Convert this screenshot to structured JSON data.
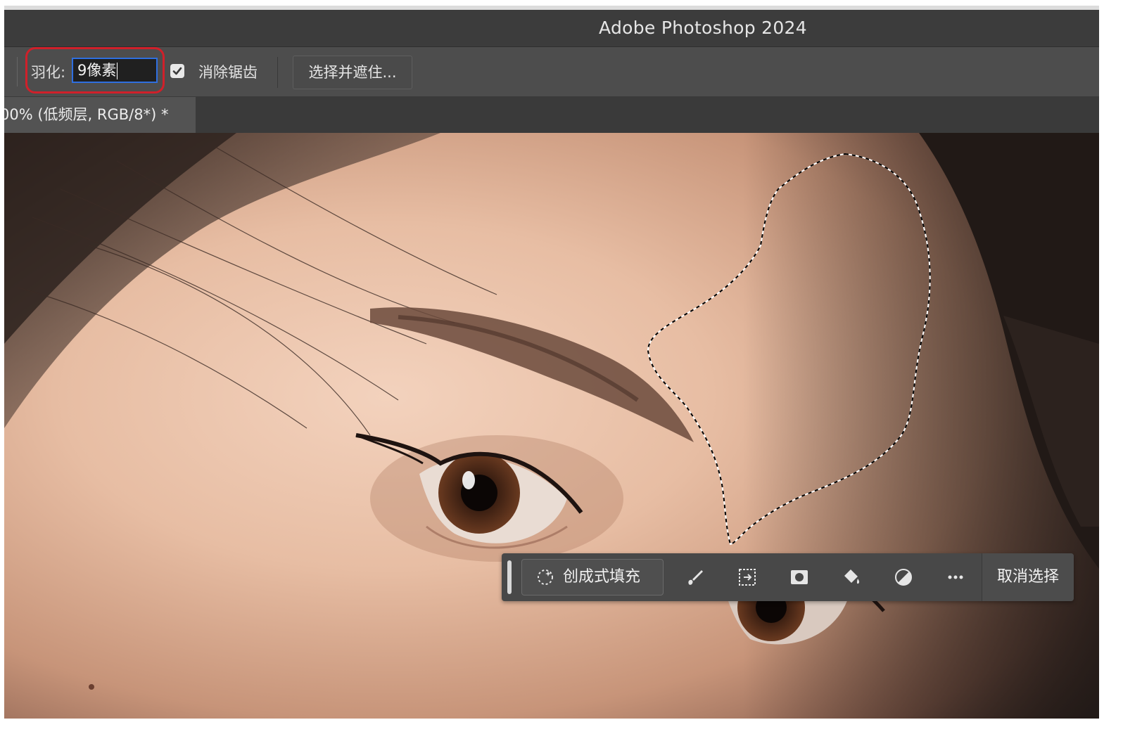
{
  "window": {
    "title": "Adobe Photoshop 2024"
  },
  "options_bar": {
    "feather_label": "羽化:",
    "feather_value": "9像素",
    "anti_alias_label": "消除锯齿",
    "anti_alias_checked": true,
    "refine_button": "选择并遮住..."
  },
  "document_tab": {
    "label": "00% (低频层, RGB/8*) *"
  },
  "contextual_taskbar": {
    "generative_fill": "创成式填充",
    "tools": [
      "brush-icon",
      "transform-selection-icon",
      "mask-icon",
      "fill-bucket-icon",
      "adjustment-icon",
      "more-icon"
    ],
    "deselect": "取消选择"
  },
  "colors": {
    "highlight_ring": "#d0202a",
    "input_focus": "#2f6fe0",
    "panel": "#4d4d4d"
  }
}
